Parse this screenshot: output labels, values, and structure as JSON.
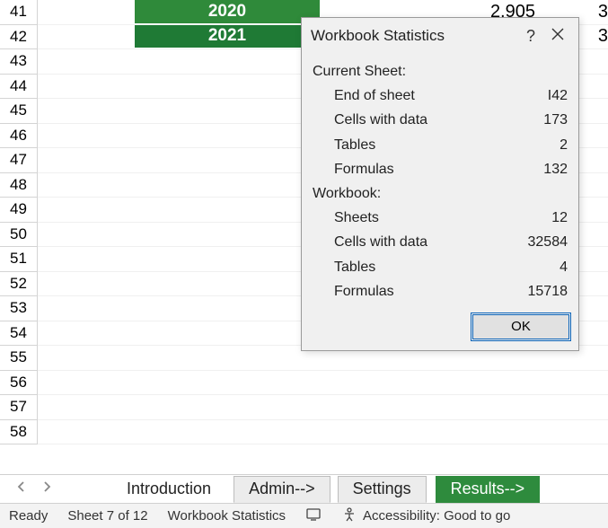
{
  "rows": {
    "headers": [
      "41",
      "42",
      "43",
      "44",
      "45",
      "46",
      "47",
      "48",
      "49",
      "50",
      "51",
      "52",
      "53",
      "54",
      "55",
      "56",
      "57",
      "58"
    ],
    "year_41": "2020",
    "year_42": "2021",
    "num_41": "2,905",
    "edge_41": "3",
    "edge_42": "3"
  },
  "dialog": {
    "title": "Workbook Statistics",
    "help": "?",
    "current_sheet_label": "Current Sheet:",
    "workbook_label": "Workbook:",
    "sheet": {
      "end_label": "End of sheet",
      "end_val": "I42",
      "cells_label": "Cells with data",
      "cells_val": "173",
      "tables_label": "Tables",
      "tables_val": "2",
      "formulas_label": "Formulas",
      "formulas_val": "132"
    },
    "wb": {
      "sheets_label": "Sheets",
      "sheets_val": "12",
      "cells_label": "Cells with data",
      "cells_val": "32584",
      "tables_label": "Tables",
      "tables_val": "4",
      "formulas_label": "Formulas",
      "formulas_val": "15718"
    },
    "ok": "OK"
  },
  "tabs": {
    "introduction": "Introduction",
    "admin": "Admin-->",
    "settings": "Settings",
    "results": "Results-->"
  },
  "status": {
    "ready": "Ready",
    "sheet": "Sheet 7 of 12",
    "stats": "Workbook Statistics",
    "accessibility": "Accessibility: Good to go"
  }
}
